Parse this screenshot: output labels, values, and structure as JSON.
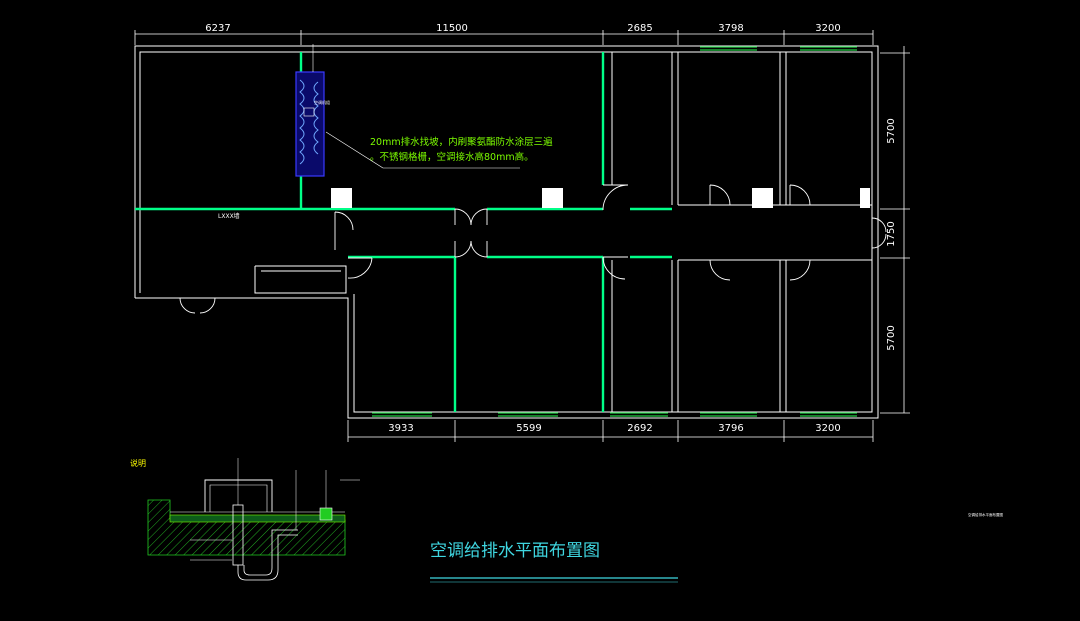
{
  "colors": {
    "background": "#000000",
    "wall": "#ffffff",
    "pipe": "#00ff88",
    "window": "#22cc44",
    "dimension": "#ffffff",
    "note": "#7CFC00",
    "title": "#3fd6e0",
    "equipment": "#2a2aff"
  },
  "dimensions": {
    "top": [
      "6237",
      "11500",
      "2685",
      "3798",
      "3200"
    ],
    "bottom": [
      "3933",
      "5599",
      "2692",
      "3796",
      "3200"
    ],
    "right": [
      "5700",
      "1750",
      "5700"
    ]
  },
  "annotation": {
    "line1": "20mm排水找坡，内刷聚氨酯防水涂层三遍",
    "line2": "。不锈钢格栅，空调接水高80mm高。"
  },
  "labels": {
    "corridor": "LXXX墙",
    "equipment_tag": "空调机组",
    "detail_note": "说明",
    "small_right": "空调给排水平面布置图"
  },
  "title": "空调给排水平面布置图"
}
